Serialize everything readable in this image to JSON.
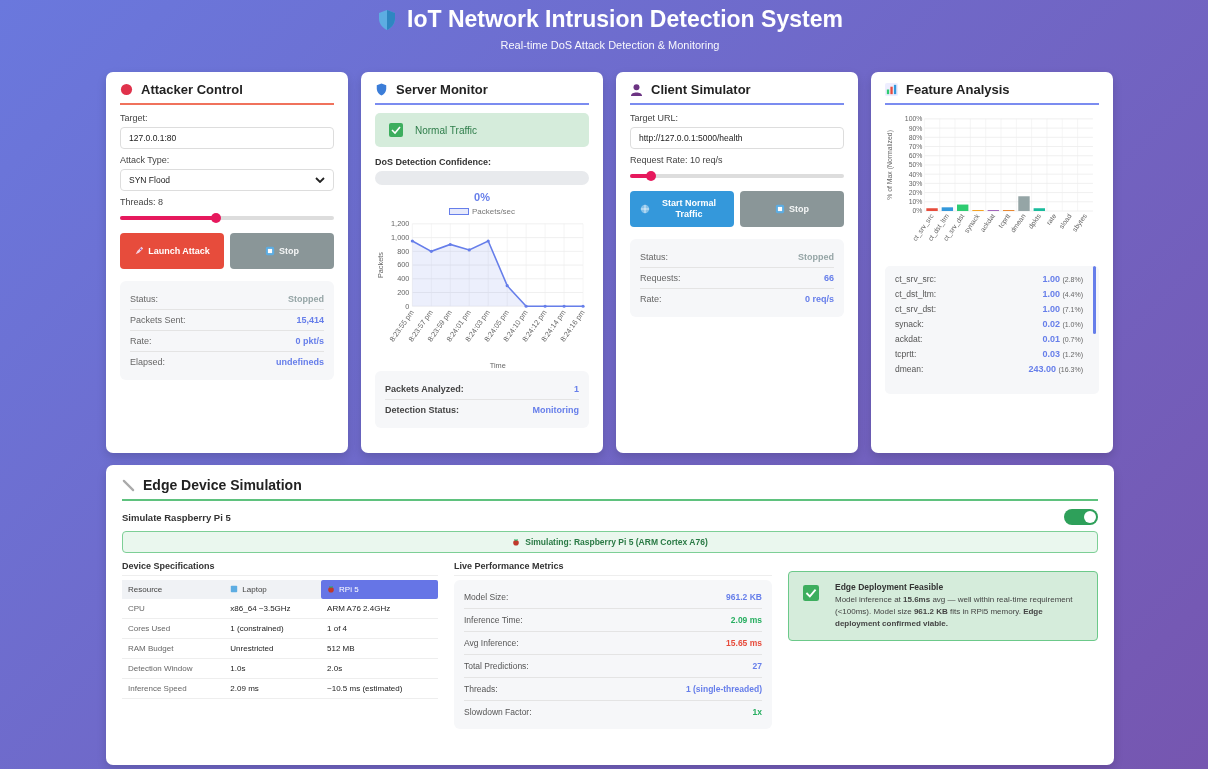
{
  "header": {
    "title": "IoT Network Intrusion Detection System",
    "subtitle": "Real-time DoS Attack Detection & Monitoring"
  },
  "attacker": {
    "title": "Attacker Control",
    "target_label": "Target:",
    "target": "127.0.0.1:80",
    "type_label": "Attack Type:",
    "type": "SYN Flood",
    "threads_label": "Threads: 8",
    "threads": {
      "level": 0.45
    },
    "buttons": [
      {
        "kind": "launch",
        "label": "Launch Attack",
        "disabled": false
      },
      {
        "kind": "stop",
        "label": "Stop",
        "disabled": true
      }
    ],
    "stats": [
      {
        "label": "Status:",
        "value": "Stopped",
        "color": "#95a5a6"
      },
      {
        "label": "Packets Sent:",
        "value": "15,414",
        "color": "#667eea"
      },
      {
        "label": "Rate:",
        "value": "0 pkt/s",
        "color": "#667eea"
      },
      {
        "label": "Elapsed:",
        "value": "undefineds",
        "color": "#667eea"
      }
    ]
  },
  "server": {
    "title": "Server Monitor",
    "alert": {
      "kind": "normal",
      "text": "Normal Traffic"
    },
    "confidence_label": "DoS Detection Confidence:",
    "confidence": {
      "level": 0
    },
    "confidence_text": "0%",
    "chart_data": {
      "type": "line",
      "grid": true,
      "xlabel": "Time",
      "ylabel": "Packets",
      "categories": [
        "8:23:55 pm",
        "8:23:57 pm",
        "8:23:59 pm",
        "8:24:01 pm",
        "8:24:03 pm",
        "8:24:05 pm",
        "8:24:10 pm",
        "8:24:12 pm",
        "8:24:14 pm",
        "8:24:16 pm"
      ],
      "ylim": [
        0,
        1200
      ],
      "yticks": [
        0,
        200,
        400,
        600,
        800,
        {
          "value": 1000,
          "label": "1,000"
        },
        {
          "value": 1200,
          "label": "1,200"
        }
      ],
      "series": [
        {
          "name": "Packets/sec",
          "color": "#667eea",
          "values": [
            950,
            800,
            900,
            820,
            950,
            300,
            0,
            0,
            0,
            0
          ]
        }
      ]
    },
    "stats": [
      {
        "label": "Packets Analyzed:",
        "value": "1",
        "color": "#667eea"
      },
      {
        "label": "Detection Status:",
        "value": "Monitoring",
        "color": "#667eea"
      }
    ]
  },
  "client": {
    "title": "Client Simulator",
    "url_label": "Target URL:",
    "url": "http://127.0.0.1:5000/health",
    "rate_label": "Request Rate: 10 req/s",
    "rate": {
      "level": 0.1
    },
    "buttons": [
      {
        "kind": "start",
        "label": "Start Normal Traffic",
        "disabled": false
      },
      {
        "kind": "stop",
        "label": "Stop",
        "disabled": true
      }
    ],
    "stats": [
      {
        "label": "Status:",
        "value": "Stopped",
        "color": "#95a5a6"
      },
      {
        "label": "Requests:",
        "value": "66",
        "color": "#667eea"
      },
      {
        "label": "Rate:",
        "value": "0 req/s",
        "color": "#667eea"
      }
    ]
  },
  "features": {
    "title": "Feature Analysis",
    "chart_data": {
      "type": "bar",
      "grid": true,
      "ylabel": "% of Max (Normalized)",
      "categories": [
        "ct_srv_src",
        "ct_dst_ltm",
        "ct_srv_dst",
        "synack",
        "ackdat",
        "tcprtt",
        "dmean",
        "dpkts",
        "rate",
        "sload",
        "sbytes"
      ],
      "ylim": [
        0,
        100
      ],
      "yticks": [
        {
          "value": 0,
          "label": "0%"
        },
        {
          "value": 10,
          "label": "10%"
        },
        {
          "value": 20,
          "label": "20%"
        },
        {
          "value": 30,
          "label": "30%"
        },
        {
          "value": 40,
          "label": "40%"
        },
        {
          "value": 50,
          "label": "50%"
        },
        {
          "value": 60,
          "label": "60%"
        },
        {
          "value": 70,
          "label": "70%"
        },
        {
          "value": 80,
          "label": "80%"
        },
        {
          "value": 90,
          "label": "90%"
        },
        {
          "value": 100,
          "label": "100%"
        }
      ],
      "values": [
        3,
        4,
        7,
        1,
        1,
        1,
        16,
        3,
        0,
        0,
        0
      ]
    },
    "items": [
      {
        "name": "ct_srv_src:",
        "value": "1.00",
        "share": "(2.8%)"
      },
      {
        "name": "ct_dst_ltm:",
        "value": "1.00",
        "share": "(4.4%)"
      },
      {
        "name": "ct_srv_dst:",
        "value": "1.00",
        "share": "(7.1%)"
      },
      {
        "name": "synack:",
        "value": "0.02",
        "share": "(1.0%)"
      },
      {
        "name": "ackdat:",
        "value": "0.01",
        "share": "(0.7%)"
      },
      {
        "name": "tcprtt:",
        "value": "0.03",
        "share": "(1.2%)"
      },
      {
        "name": "dmean:",
        "value": "243.00",
        "share": "(16.3%)"
      }
    ]
  },
  "edge": {
    "title": "Edge Device Simulation",
    "toggle_label": "Simulate Raspberry Pi 5",
    "toggle_on": true,
    "banner": "Simulating: Raspberry Pi 5 (ARM Cortex A76)",
    "specs_title": "Device Specifications",
    "columns": [
      {
        "label": "Resource",
        "kind": "plain",
        "selected": false
      },
      {
        "label": "Laptop",
        "kind": "laptop",
        "selected": false
      },
      {
        "label": "RPi 5",
        "kind": "pi",
        "selected": true
      }
    ],
    "rows": [
      [
        "CPU",
        "x86_64 ~3.5GHz",
        "ARM A76 2.4GHz"
      ],
      [
        "Cores Used",
        "1 (constrained)",
        "1 of 4"
      ],
      [
        "RAM Budget",
        "Unrestricted",
        "512 MB"
      ],
      [
        "Detection Window",
        "1.0s",
        "2.0s"
      ],
      [
        "Inference Speed",
        "2.09 ms",
        "~10.5 ms (estimated)"
      ]
    ],
    "metrics_title": "Live Performance Metrics",
    "metrics": [
      {
        "label": "Model Size:",
        "value": "961.2 KB",
        "color": "#667eea"
      },
      {
        "label": "Inference Time:",
        "value": "2.09 ms",
        "color": "#27ae60"
      },
      {
        "label": "Avg Inference:",
        "value": "15.65 ms",
        "color": "#e74c3c"
      },
      {
        "label": "Total Predictions:",
        "value": "27",
        "color": "#667eea"
      },
      {
        "label": "Threads:",
        "value": "1 (single-threaded)",
        "color": "#667eea"
      },
      {
        "label": "Slowdown Factor:",
        "value": "1x",
        "color": "#27ae60"
      }
    ],
    "verdict": {
      "feasible": true,
      "title": "Edge Deployment Feasible",
      "text": "Model inference at **15.6ms** avg — well within real-time requirement (<100ms). Model size **961.2 KB** fits in RPi5 memory. **Edge deployment confirmed viable.**"
    }
  }
}
